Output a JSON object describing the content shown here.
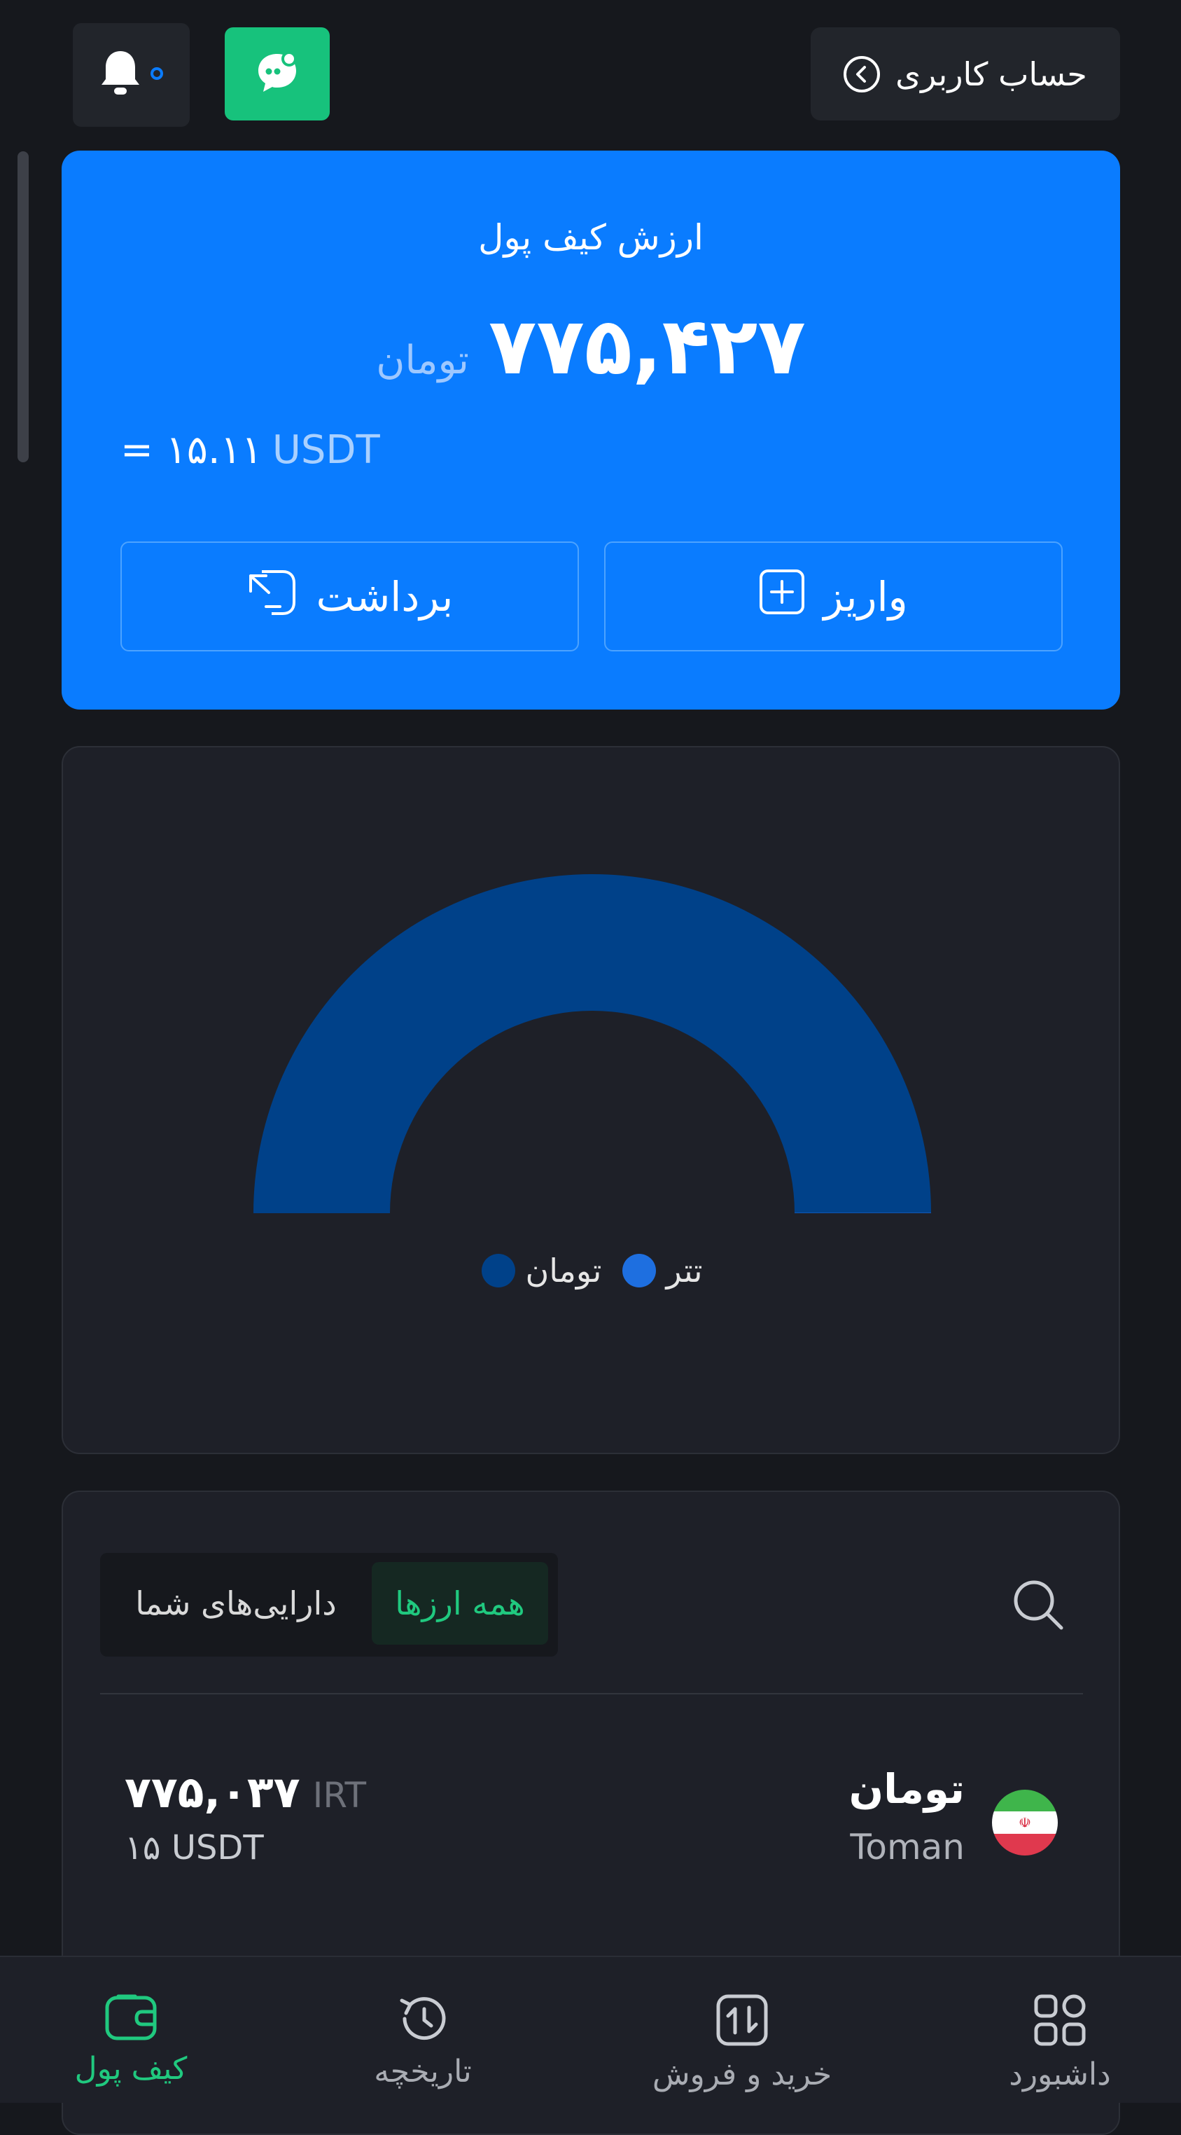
{
  "header": {
    "account_label": "حساب کاربری"
  },
  "wallet": {
    "title": "ارزش کیف پول",
    "amount": "۷۷۵,۴۲۷",
    "amount_unit": "تومان",
    "equals": "= ۱۵.۱۱",
    "usdt_unit": "USDT",
    "deposit_label": "واریز",
    "withdraw_label": "برداشت"
  },
  "chart_data": {
    "type": "pie",
    "categories": [
      "تتر",
      "تومان"
    ],
    "values": [
      0.05,
      99.95
    ],
    "colors": [
      "#1e6fe0",
      "#004189"
    ],
    "legend": [
      "تتر",
      "تومان"
    ]
  },
  "assets": {
    "tabs": [
      "همه ارزها",
      "دارایی‌های شما"
    ],
    "active_tab": "همه ارزها",
    "rows": [
      {
        "name": "تومان",
        "subname": "Toman",
        "amount": "۷۷۵,۰۳۷",
        "unit": "IRT",
        "usdt": "۱۵ USDT"
      }
    ]
  },
  "nav": {
    "items": [
      {
        "label": "کیف پول",
        "icon": "wallet-icon",
        "active": true
      },
      {
        "label": "تاریخچه",
        "icon": "history-icon",
        "active": false
      },
      {
        "label": "خرید و فروش",
        "icon": "exchange-icon",
        "active": false
      },
      {
        "label": "داشبورد",
        "icon": "dashboard-icon",
        "active": false
      }
    ]
  },
  "colors": {
    "background": "#16181d",
    "card": "#1e2028",
    "accent_blue": "#0a7cff",
    "accent_green": "#20c97f"
  }
}
